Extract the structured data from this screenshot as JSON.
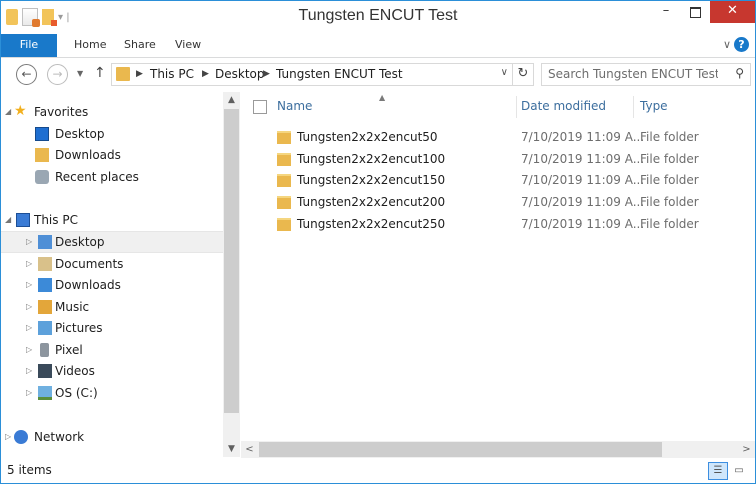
{
  "window": {
    "title": "Tungsten ENCUT Test"
  },
  "title_controls": {
    "minimize": "–",
    "close": "✕"
  },
  "ribbon": {
    "tabs": [
      "File",
      "Home",
      "Share",
      "View"
    ],
    "help": "?"
  },
  "address": {
    "crumbs": [
      "This PC",
      "Desktop",
      "Tungsten ENCUT Test"
    ],
    "search_placeholder": "Search Tungsten ENCUT Test"
  },
  "nav_pane": {
    "favorites": {
      "label": "Favorites",
      "items": [
        "Desktop",
        "Downloads",
        "Recent places"
      ]
    },
    "this_pc": {
      "label": "This PC",
      "items": [
        "Desktop",
        "Documents",
        "Downloads",
        "Music",
        "Pictures",
        "Pixel",
        "Videos",
        "OS (C:)"
      ]
    },
    "network": {
      "label": "Network"
    }
  },
  "columns": {
    "name": "Name",
    "date_modified": "Date modified",
    "type": "Type"
  },
  "files": [
    {
      "name": "Tungsten2x2x2encut50",
      "date": "7/10/2019 11:09 A...",
      "type": "File folder"
    },
    {
      "name": "Tungsten2x2x2encut100",
      "date": "7/10/2019 11:09 A...",
      "type": "File folder"
    },
    {
      "name": "Tungsten2x2x2encut150",
      "date": "7/10/2019 11:09 A...",
      "type": "File folder"
    },
    {
      "name": "Tungsten2x2x2encut200",
      "date": "7/10/2019 11:09 A...",
      "type": "File folder"
    },
    {
      "name": "Tungsten2x2x2encut250",
      "date": "7/10/2019 11:09 A...",
      "type": "File folder"
    }
  ],
  "status": {
    "item_count": "5 items"
  },
  "colors": {
    "accent": "#1979ca",
    "close": "#c7372f",
    "header_text": "#3c6e9e"
  }
}
